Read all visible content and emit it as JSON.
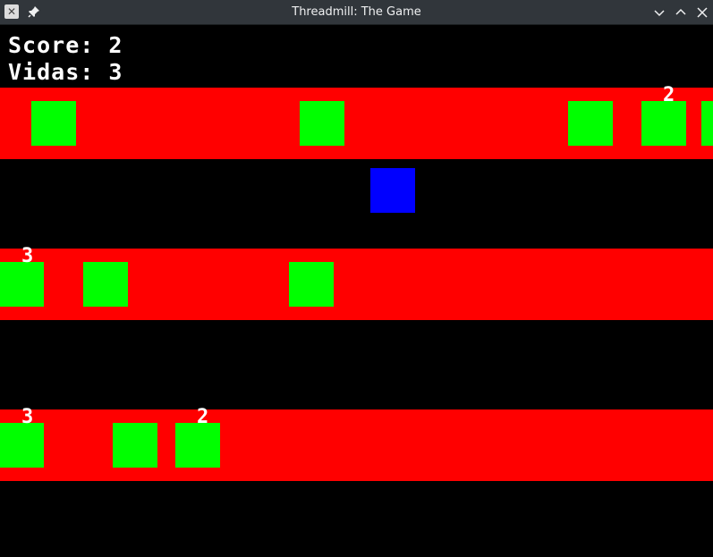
{
  "window": {
    "title": "Threadmill: The Game",
    "app_icon": "app-icon",
    "pin_icon": "pin-icon",
    "controls": [
      "minimize-icon",
      "maximize-icon",
      "close-icon"
    ]
  },
  "hud": {
    "score_text": "Score: 2",
    "lives_text": "Vidas: 3"
  },
  "colors": {
    "background": "#000000",
    "lane": "#ff0000",
    "block": "#00ff00",
    "player": "#0000ff",
    "text": "#ffffff"
  },
  "lanes": [
    {
      "blocks": [
        {
          "label": ""
        },
        {
          "label": ""
        },
        {
          "label": ""
        },
        {
          "label": "2"
        },
        {
          "label": ""
        }
      ]
    },
    {
      "blocks": [
        {
          "label": "3"
        },
        {
          "label": ""
        },
        {
          "label": ""
        }
      ]
    },
    {
      "blocks": [
        {
          "label": "3"
        },
        {
          "label": ""
        },
        {
          "label": "2"
        }
      ]
    }
  ]
}
